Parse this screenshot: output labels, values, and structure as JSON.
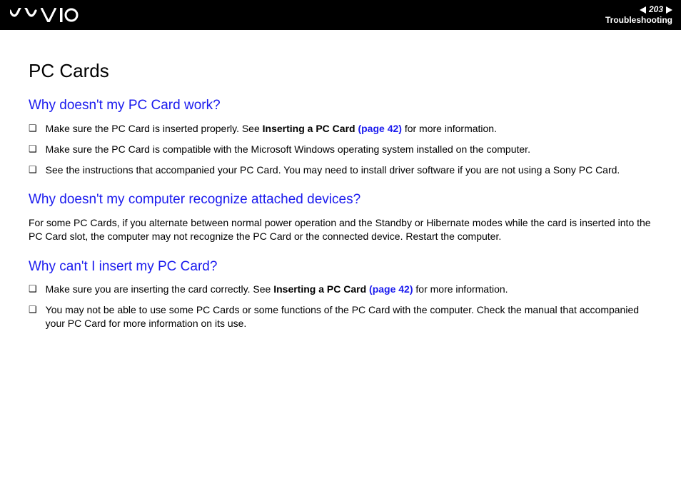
{
  "header": {
    "page_number": "203",
    "section_label": "Troubleshooting"
  },
  "content": {
    "title": "PC Cards",
    "sections": [
      {
        "heading": "Why doesn't my PC Card work?",
        "type": "list",
        "items": [
          {
            "pre": "Make sure the PC Card is inserted properly. See ",
            "bold": "Inserting a PC Card ",
            "link": "(page 42)",
            "post": " for more information."
          },
          {
            "pre": "Make sure the PC Card is compatible with the Microsoft Windows operating system installed on the computer.",
            "bold": "",
            "link": "",
            "post": ""
          },
          {
            "pre": "See the instructions that accompanied your PC Card. You may need to install driver software if you are not using a Sony PC Card.",
            "bold": "",
            "link": "",
            "post": ""
          }
        ]
      },
      {
        "heading": "Why doesn't my computer recognize attached devices?",
        "type": "paragraph",
        "text": "For some PC Cards, if you alternate between normal power operation and the Standby or Hibernate modes while the card is inserted into the PC Card slot, the computer may not recognize the PC Card or the connected device. Restart the computer."
      },
      {
        "heading": "Why can't I insert my PC Card?",
        "type": "list",
        "items": [
          {
            "pre": "Make sure you are inserting the card correctly. See ",
            "bold": "Inserting a PC Card ",
            "link": "(page 42)",
            "post": " for more information."
          },
          {
            "pre": "You may not be able to use some PC Cards or some functions of the PC Card with the computer. Check the manual that accompanied your PC Card for more information on its use.",
            "bold": "",
            "link": "",
            "post": ""
          }
        ]
      }
    ]
  },
  "bullet_glyph": "❑"
}
